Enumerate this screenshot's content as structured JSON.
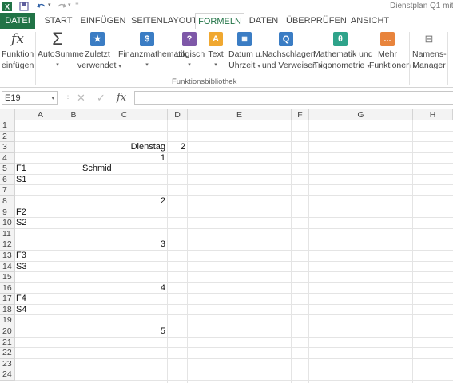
{
  "title": {
    "document": "Dienstplan Q1 mit"
  },
  "tabs": [
    "DATEI",
    "START",
    "EINFÜGEN",
    "SEITENLAYOUT",
    "FORMELN",
    "DATEN",
    "ÜBERPRÜFEN",
    "ANSICHT"
  ],
  "ribbon": {
    "insert_function": [
      "Funktion",
      "einfügen"
    ],
    "autosum": "AutoSumme",
    "recent": [
      "Zuletzt",
      "verwendet"
    ],
    "financial": "Finanzmathematik",
    "logical": "Logisch",
    "text": "Text",
    "datetime": [
      "Datum u.",
      "Uhrzeit"
    ],
    "lookup": [
      "Nachschlagen",
      "und Verweisen"
    ],
    "math": [
      "Mathematik und",
      "Trigonometrie"
    ],
    "more": [
      "Mehr",
      "Funktionen"
    ],
    "name_manager": [
      "Namens-",
      "Manager"
    ],
    "group_label": "Funktionsbibliothek",
    "icon_letters": {
      "financial": "$",
      "logical": "?",
      "text": "A",
      "lookup": "Q",
      "math": "θ",
      "more": "..."
    },
    "colors": {
      "financial": "#3b7dc4",
      "logical": "#7e58a8",
      "text": "#f0a830",
      "datetime": "#3b7dc4",
      "lookup": "#3b7dc4",
      "math": "#2ea38a",
      "more": "#e8843c"
    }
  },
  "formula_bar": {
    "name_box": "E19",
    "fx": "fx",
    "value": ""
  },
  "columns": [
    "A",
    "B",
    "C",
    "D",
    "E",
    "F",
    "G",
    "H"
  ],
  "rows": [
    "1",
    "2",
    "3",
    "4",
    "5",
    "6",
    "7",
    "8",
    "9",
    "10",
    "11",
    "12",
    "13",
    "14",
    "15",
    "16",
    "17",
    "18",
    "19",
    "20",
    "21",
    "22",
    "23",
    "24"
  ],
  "cells": {
    "C3": "Dienstag",
    "D3": "2",
    "C4": "1",
    "A5": "F1",
    "C5": "Schmid",
    "A6": "S1",
    "C8": "2",
    "A9": "F2",
    "A10": "S2",
    "C12": "3",
    "A13": "F3",
    "A14": "S3",
    "C16": "4",
    "A17": "F4",
    "A18": "S4",
    "C20": "5"
  },
  "accent": "#217346"
}
